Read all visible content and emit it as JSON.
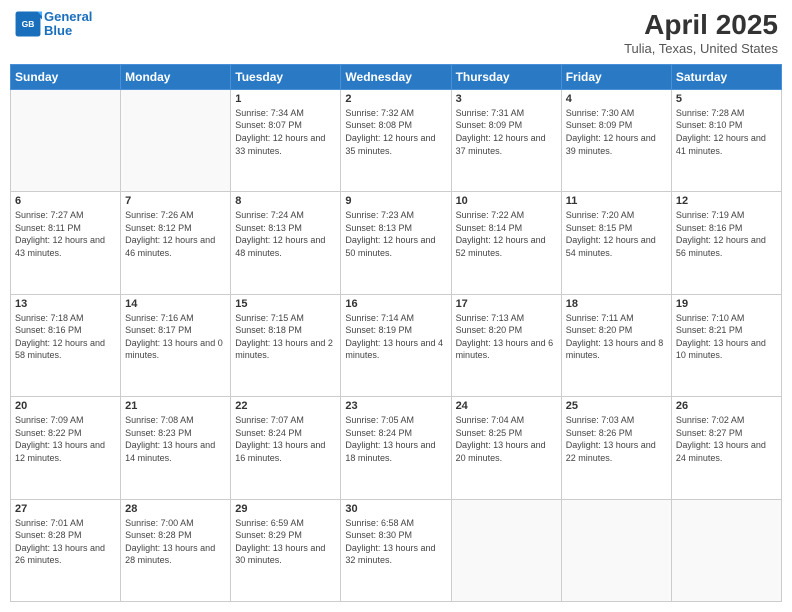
{
  "header": {
    "logo_line1": "General",
    "logo_line2": "Blue",
    "month_title": "April 2025",
    "location": "Tulia, Texas, United States"
  },
  "days_of_week": [
    "Sunday",
    "Monday",
    "Tuesday",
    "Wednesday",
    "Thursday",
    "Friday",
    "Saturday"
  ],
  "weeks": [
    [
      {
        "num": "",
        "sunrise": "",
        "sunset": "",
        "daylight": ""
      },
      {
        "num": "",
        "sunrise": "",
        "sunset": "",
        "daylight": ""
      },
      {
        "num": "1",
        "sunrise": "Sunrise: 7:34 AM",
        "sunset": "Sunset: 8:07 PM",
        "daylight": "Daylight: 12 hours and 33 minutes."
      },
      {
        "num": "2",
        "sunrise": "Sunrise: 7:32 AM",
        "sunset": "Sunset: 8:08 PM",
        "daylight": "Daylight: 12 hours and 35 minutes."
      },
      {
        "num": "3",
        "sunrise": "Sunrise: 7:31 AM",
        "sunset": "Sunset: 8:09 PM",
        "daylight": "Daylight: 12 hours and 37 minutes."
      },
      {
        "num": "4",
        "sunrise": "Sunrise: 7:30 AM",
        "sunset": "Sunset: 8:09 PM",
        "daylight": "Daylight: 12 hours and 39 minutes."
      },
      {
        "num": "5",
        "sunrise": "Sunrise: 7:28 AM",
        "sunset": "Sunset: 8:10 PM",
        "daylight": "Daylight: 12 hours and 41 minutes."
      }
    ],
    [
      {
        "num": "6",
        "sunrise": "Sunrise: 7:27 AM",
        "sunset": "Sunset: 8:11 PM",
        "daylight": "Daylight: 12 hours and 43 minutes."
      },
      {
        "num": "7",
        "sunrise": "Sunrise: 7:26 AM",
        "sunset": "Sunset: 8:12 PM",
        "daylight": "Daylight: 12 hours and 46 minutes."
      },
      {
        "num": "8",
        "sunrise": "Sunrise: 7:24 AM",
        "sunset": "Sunset: 8:13 PM",
        "daylight": "Daylight: 12 hours and 48 minutes."
      },
      {
        "num": "9",
        "sunrise": "Sunrise: 7:23 AM",
        "sunset": "Sunset: 8:13 PM",
        "daylight": "Daylight: 12 hours and 50 minutes."
      },
      {
        "num": "10",
        "sunrise": "Sunrise: 7:22 AM",
        "sunset": "Sunset: 8:14 PM",
        "daylight": "Daylight: 12 hours and 52 minutes."
      },
      {
        "num": "11",
        "sunrise": "Sunrise: 7:20 AM",
        "sunset": "Sunset: 8:15 PM",
        "daylight": "Daylight: 12 hours and 54 minutes."
      },
      {
        "num": "12",
        "sunrise": "Sunrise: 7:19 AM",
        "sunset": "Sunset: 8:16 PM",
        "daylight": "Daylight: 12 hours and 56 minutes."
      }
    ],
    [
      {
        "num": "13",
        "sunrise": "Sunrise: 7:18 AM",
        "sunset": "Sunset: 8:16 PM",
        "daylight": "Daylight: 12 hours and 58 minutes."
      },
      {
        "num": "14",
        "sunrise": "Sunrise: 7:16 AM",
        "sunset": "Sunset: 8:17 PM",
        "daylight": "Daylight: 13 hours and 0 minutes."
      },
      {
        "num": "15",
        "sunrise": "Sunrise: 7:15 AM",
        "sunset": "Sunset: 8:18 PM",
        "daylight": "Daylight: 13 hours and 2 minutes."
      },
      {
        "num": "16",
        "sunrise": "Sunrise: 7:14 AM",
        "sunset": "Sunset: 8:19 PM",
        "daylight": "Daylight: 13 hours and 4 minutes."
      },
      {
        "num": "17",
        "sunrise": "Sunrise: 7:13 AM",
        "sunset": "Sunset: 8:20 PM",
        "daylight": "Daylight: 13 hours and 6 minutes."
      },
      {
        "num": "18",
        "sunrise": "Sunrise: 7:11 AM",
        "sunset": "Sunset: 8:20 PM",
        "daylight": "Daylight: 13 hours and 8 minutes."
      },
      {
        "num": "19",
        "sunrise": "Sunrise: 7:10 AM",
        "sunset": "Sunset: 8:21 PM",
        "daylight": "Daylight: 13 hours and 10 minutes."
      }
    ],
    [
      {
        "num": "20",
        "sunrise": "Sunrise: 7:09 AM",
        "sunset": "Sunset: 8:22 PM",
        "daylight": "Daylight: 13 hours and 12 minutes."
      },
      {
        "num": "21",
        "sunrise": "Sunrise: 7:08 AM",
        "sunset": "Sunset: 8:23 PM",
        "daylight": "Daylight: 13 hours and 14 minutes."
      },
      {
        "num": "22",
        "sunrise": "Sunrise: 7:07 AM",
        "sunset": "Sunset: 8:24 PM",
        "daylight": "Daylight: 13 hours and 16 minutes."
      },
      {
        "num": "23",
        "sunrise": "Sunrise: 7:05 AM",
        "sunset": "Sunset: 8:24 PM",
        "daylight": "Daylight: 13 hours and 18 minutes."
      },
      {
        "num": "24",
        "sunrise": "Sunrise: 7:04 AM",
        "sunset": "Sunset: 8:25 PM",
        "daylight": "Daylight: 13 hours and 20 minutes."
      },
      {
        "num": "25",
        "sunrise": "Sunrise: 7:03 AM",
        "sunset": "Sunset: 8:26 PM",
        "daylight": "Daylight: 13 hours and 22 minutes."
      },
      {
        "num": "26",
        "sunrise": "Sunrise: 7:02 AM",
        "sunset": "Sunset: 8:27 PM",
        "daylight": "Daylight: 13 hours and 24 minutes."
      }
    ],
    [
      {
        "num": "27",
        "sunrise": "Sunrise: 7:01 AM",
        "sunset": "Sunset: 8:28 PM",
        "daylight": "Daylight: 13 hours and 26 minutes."
      },
      {
        "num": "28",
        "sunrise": "Sunrise: 7:00 AM",
        "sunset": "Sunset: 8:28 PM",
        "daylight": "Daylight: 13 hours and 28 minutes."
      },
      {
        "num": "29",
        "sunrise": "Sunrise: 6:59 AM",
        "sunset": "Sunset: 8:29 PM",
        "daylight": "Daylight: 13 hours and 30 minutes."
      },
      {
        "num": "30",
        "sunrise": "Sunrise: 6:58 AM",
        "sunset": "Sunset: 8:30 PM",
        "daylight": "Daylight: 13 hours and 32 minutes."
      },
      {
        "num": "",
        "sunrise": "",
        "sunset": "",
        "daylight": ""
      },
      {
        "num": "",
        "sunrise": "",
        "sunset": "",
        "daylight": ""
      },
      {
        "num": "",
        "sunrise": "",
        "sunset": "",
        "daylight": ""
      }
    ]
  ]
}
